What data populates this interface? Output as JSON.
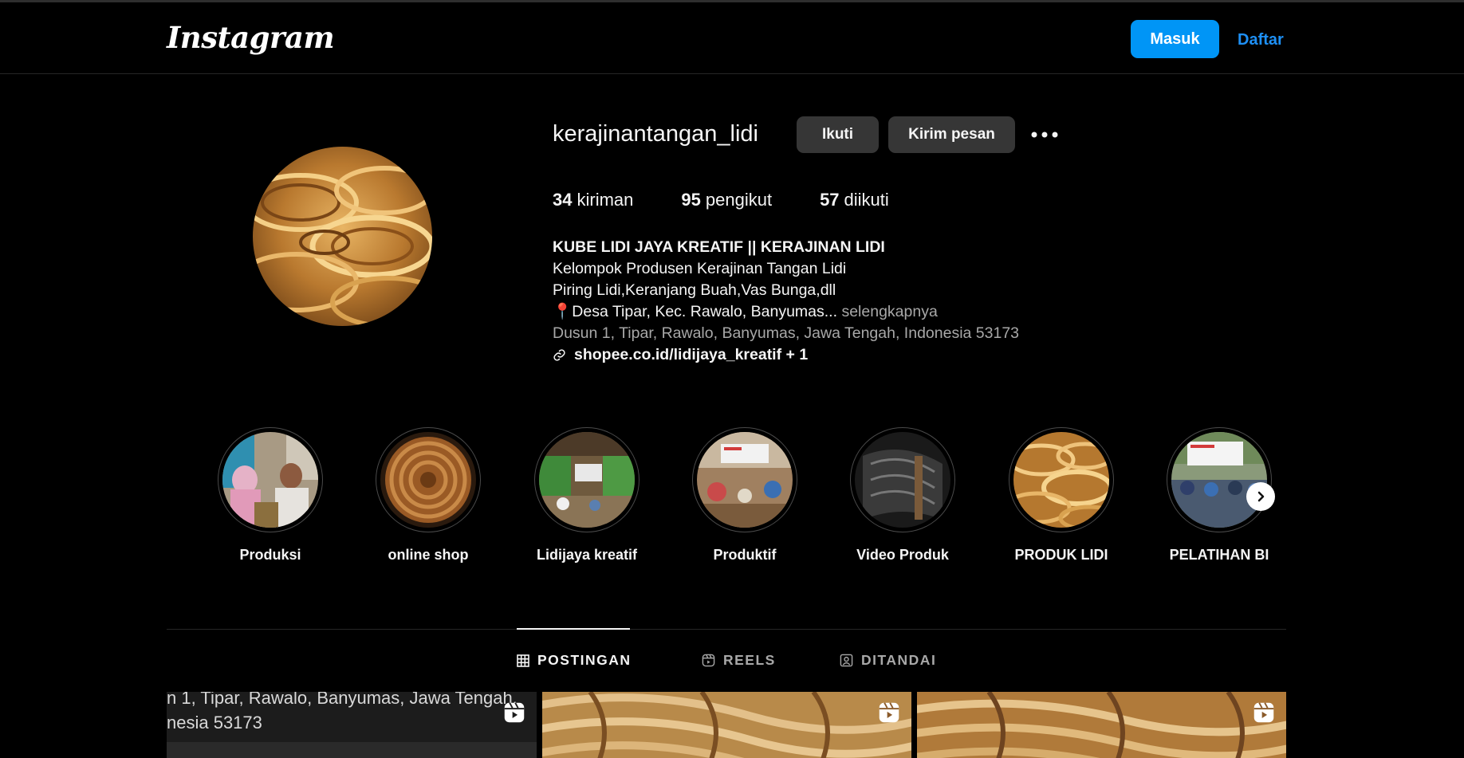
{
  "header": {
    "logo": "Instagram",
    "login_label": "Masuk",
    "signup_label": "Daftar"
  },
  "profile": {
    "username": "kerajinantangan_lidi",
    "follow_label": "Ikuti",
    "message_label": "Kirim pesan",
    "stats": {
      "posts_count": "34",
      "posts_label": "kiriman",
      "followers_count": "95",
      "followers_label": "pengikut",
      "following_count": "57",
      "following_label": "diikuti"
    },
    "bio": {
      "name": "KUBE LIDI JAYA KREATIF || KERAJINAN LIDI",
      "line1": "Kelompok Produsen Kerajinan Tangan Lidi",
      "line2": "Piring Lidi,Keranjang Buah,Vas Bunga,dll",
      "line3": "📍Desa Tipar, Kec. Rawalo, Banyumas...",
      "more_label": "selengkapnya",
      "address": "Dusun 1, Tipar, Rawalo, Banyumas, Jawa Tengah, Indonesia 53173",
      "link": "shopee.co.id/lidijaya_kreatif + 1"
    }
  },
  "highlights": [
    {
      "label": "Produksi"
    },
    {
      "label": "online shop"
    },
    {
      "label": "Lidijaya kreatif"
    },
    {
      "label": "Produktif"
    },
    {
      "label": "Video Produk"
    },
    {
      "label": "PRODUK LIDI"
    },
    {
      "label": "PELATIHAN BI"
    }
  ],
  "tabs": {
    "posts": "POSTINGAN",
    "reels": "REELS",
    "tagged": "DITANDAI"
  },
  "posts": {
    "first_text_line1": "n 1, Tipar, Rawalo, Banyumas, Jawa Tengah,",
    "first_text_line2": "nesia 53173"
  },
  "colors": {
    "accent": "#0095f6",
    "link": "#1e90f5",
    "background": "#000000",
    "button_secondary": "#363636",
    "muted_text": "#a8a8a8"
  }
}
